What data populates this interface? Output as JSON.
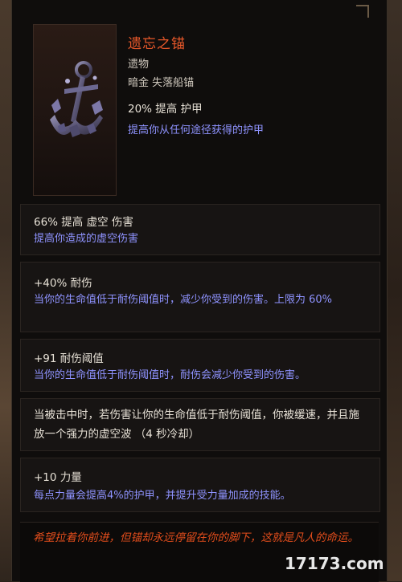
{
  "item": {
    "name": "遗忘之锚",
    "type": "遗物",
    "rarity_and_base": "暗金 失落船锚",
    "implicit": {
      "stat": "20% 提高 护甲",
      "description": "提高你从任何途径获得的护甲"
    }
  },
  "affixes": [
    {
      "stat": "66% 提高 虚空 伤害",
      "description": "提高你造成的虚空伤害"
    },
    {
      "stat": "+40% 耐伤",
      "description": "当你的生命值低于耐伤阈值时，减少你受到的伤害。上限为 60%"
    },
    {
      "stat": "+91 耐伤阈值",
      "description": "当你的生命值低于耐伤阈值时，耐伤会减少你受到的伤害。"
    },
    {
      "text": "当被击中时，若伤害让你的生命值低于耐伤阈值，你被缓速，并且施放一个强力的虚空波 （4 秒冷却）"
    },
    {
      "stat": "+10 力量",
      "description": "每点力量会提高4%的护甲，并提升受力量加成的技能。"
    }
  ],
  "lore": "希望拉着你前进，但锚却永远停留在你的脚下，这就是凡人的命运。",
  "watermark": "17173.com",
  "colors": {
    "title": "#e8582a",
    "description": "#8f93ff",
    "lore": "#e24d1c",
    "stat": "#e7e1d6"
  },
  "icons": {
    "item_image": "anchor-icon"
  }
}
